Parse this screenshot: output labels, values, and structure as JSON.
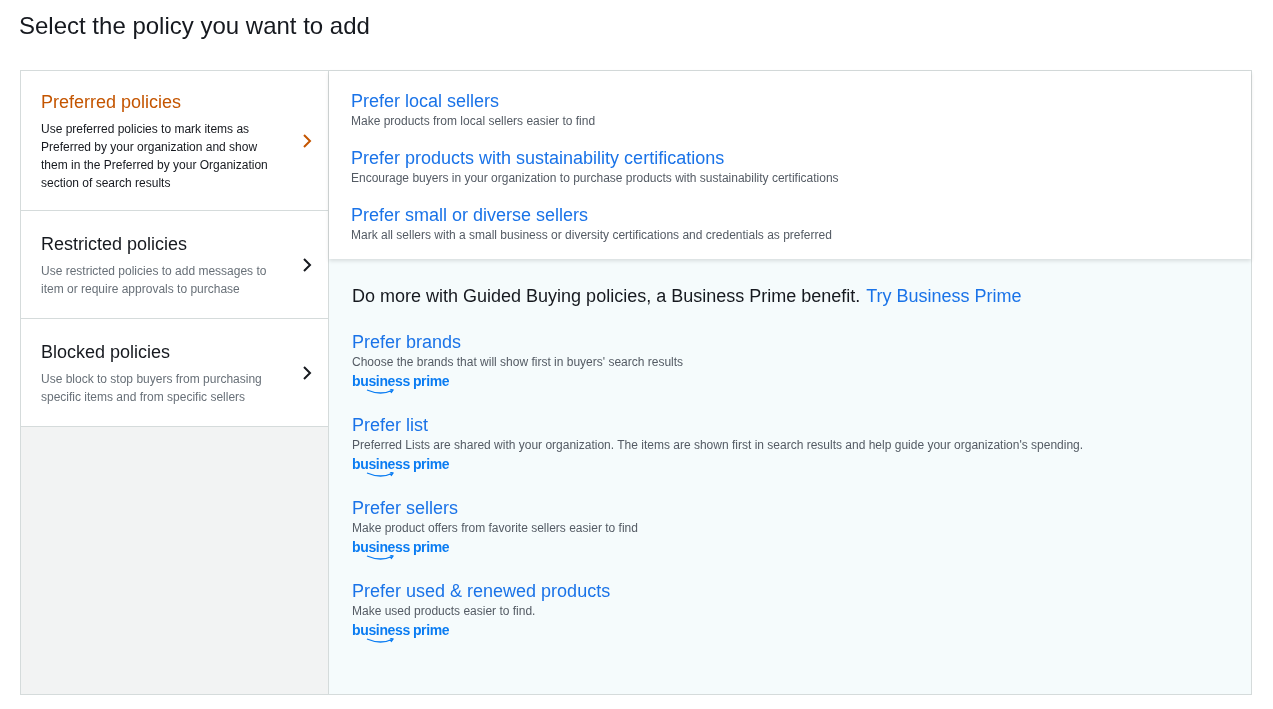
{
  "heading": "Select the policy you want to add",
  "categories": [
    {
      "title": "Preferred policies",
      "description": "Use preferred policies to mark items as Preferred by your organization and show them in the Preferred by your Organization section of search results",
      "selected": true
    },
    {
      "title": "Restricted policies",
      "description": "Use restricted policies to add messages to item or require approvals to purchase",
      "selected": false
    },
    {
      "title": "Blocked policies",
      "description": "Use block to stop buyers from purchasing specific items and from specific sellers",
      "selected": false
    }
  ],
  "policies": [
    {
      "title": "Prefer local sellers",
      "description": "Make products from local sellers easier to find"
    },
    {
      "title": "Prefer products with sustainability certifications",
      "description": "Encourage buyers in your organization to purchase products with sustainability certifications"
    },
    {
      "title": "Prefer small or diverse sellers",
      "description": "Mark all sellers with a small business or diversity certifications and credentials as preferred"
    }
  ],
  "upsell": {
    "text": "Do more with Guided Buying policies, a Business Prime benefit.",
    "link": "Try Business Prime"
  },
  "premium_policies": [
    {
      "title": "Prefer brands",
      "description": "Choose the brands that will show first in buyers' search results",
      "logo": [
        "business",
        "prime"
      ]
    },
    {
      "title": "Prefer list",
      "description": "Preferred Lists are shared with your organization. The items are shown first in search results and help guide your organization's spending.",
      "logo": [
        "business",
        "prime"
      ]
    },
    {
      "title": "Prefer sellers",
      "description": "Make product offers from favorite sellers easier to find",
      "logo": [
        "business",
        "prime"
      ]
    },
    {
      "title": "Prefer used & renewed products",
      "description": "Make used products easier to find.",
      "logo": [
        "business",
        "prime"
      ]
    }
  ]
}
